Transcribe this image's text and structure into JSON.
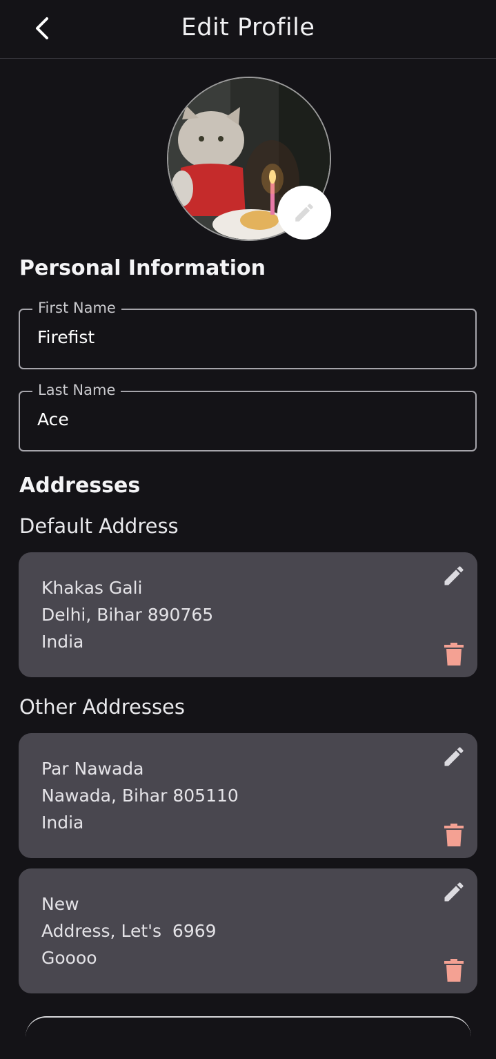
{
  "header": {
    "title": "Edit Profile",
    "back_icon": "chevron-left-icon"
  },
  "avatar": {
    "edit_icon": "pencil-icon"
  },
  "personal": {
    "heading": "Personal Information",
    "first_name": {
      "label": "First Name",
      "value": "Firefist"
    },
    "last_name": {
      "label": "Last Name",
      "value": "Ace"
    }
  },
  "addresses": {
    "heading": "Addresses",
    "default_heading": "Default Address",
    "default": {
      "line1": "Khakas Gali",
      "line2": "Delhi, Bihar 890765",
      "line3": "India"
    },
    "other_heading": "Other Addresses",
    "others": [
      {
        "line1": "Par Nawada",
        "line2": "Nawada, Bihar 805110",
        "line3": "India"
      },
      {
        "line1": "New",
        "line2": "Address, Let's  6969",
        "line3": "Goooo"
      }
    ]
  },
  "colors": {
    "background": "#141317",
    "card": "#49474f",
    "delete": "#f4a193",
    "edit": "#dcdbe0"
  }
}
